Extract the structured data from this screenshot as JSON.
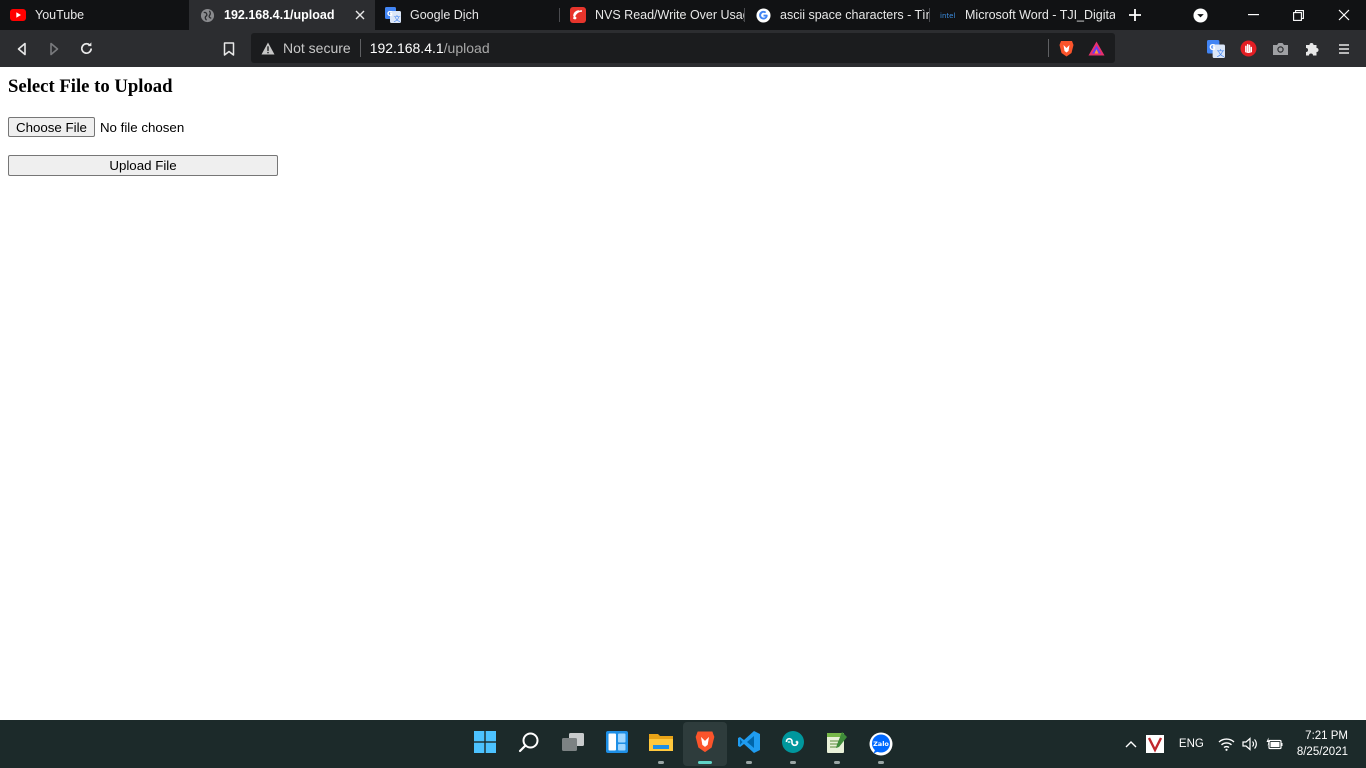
{
  "browser": {
    "tabs": [
      {
        "title": "YouTube",
        "icon": "youtube-icon",
        "active": false
      },
      {
        "title": "192.168.4.1/upload",
        "icon": "globe-icon",
        "active": true
      },
      {
        "title": "Google Dịch",
        "icon": "google-translate-icon",
        "active": false
      },
      {
        "title": "NVS Read/Write Over Usage",
        "icon": "espressif-icon",
        "active": false
      },
      {
        "title": "ascii space characters - Tìm",
        "icon": "google-icon",
        "active": false
      },
      {
        "title": "Microsoft Word - TJI_Digital",
        "icon": "intel-icon",
        "active": false
      }
    ],
    "omnibox": {
      "security_label": "Not secure",
      "url_host": "192.168.4.1",
      "url_path": "/upload"
    },
    "colors": {
      "tabstrip_bg": "#111214",
      "toolbar_bg": "#2c2d30",
      "omnibox_bg": "#1b1c1e"
    }
  },
  "page": {
    "heading": "Select File to Upload",
    "choose_file_label": "Choose File",
    "no_file_label": "No file chosen",
    "upload_button_label": "Upload File"
  },
  "taskbar": {
    "apps": [
      "start-icon",
      "search-icon",
      "task-view-icon",
      "widgets-icon",
      "file-explorer-icon",
      "brave-icon",
      "vscode-icon",
      "arduino-icon",
      "notepad-icon",
      "zalo-icon"
    ],
    "zalo_label": "Zalo",
    "language": "ENG",
    "time": "7:21 PM",
    "date": "8/25/2021"
  }
}
